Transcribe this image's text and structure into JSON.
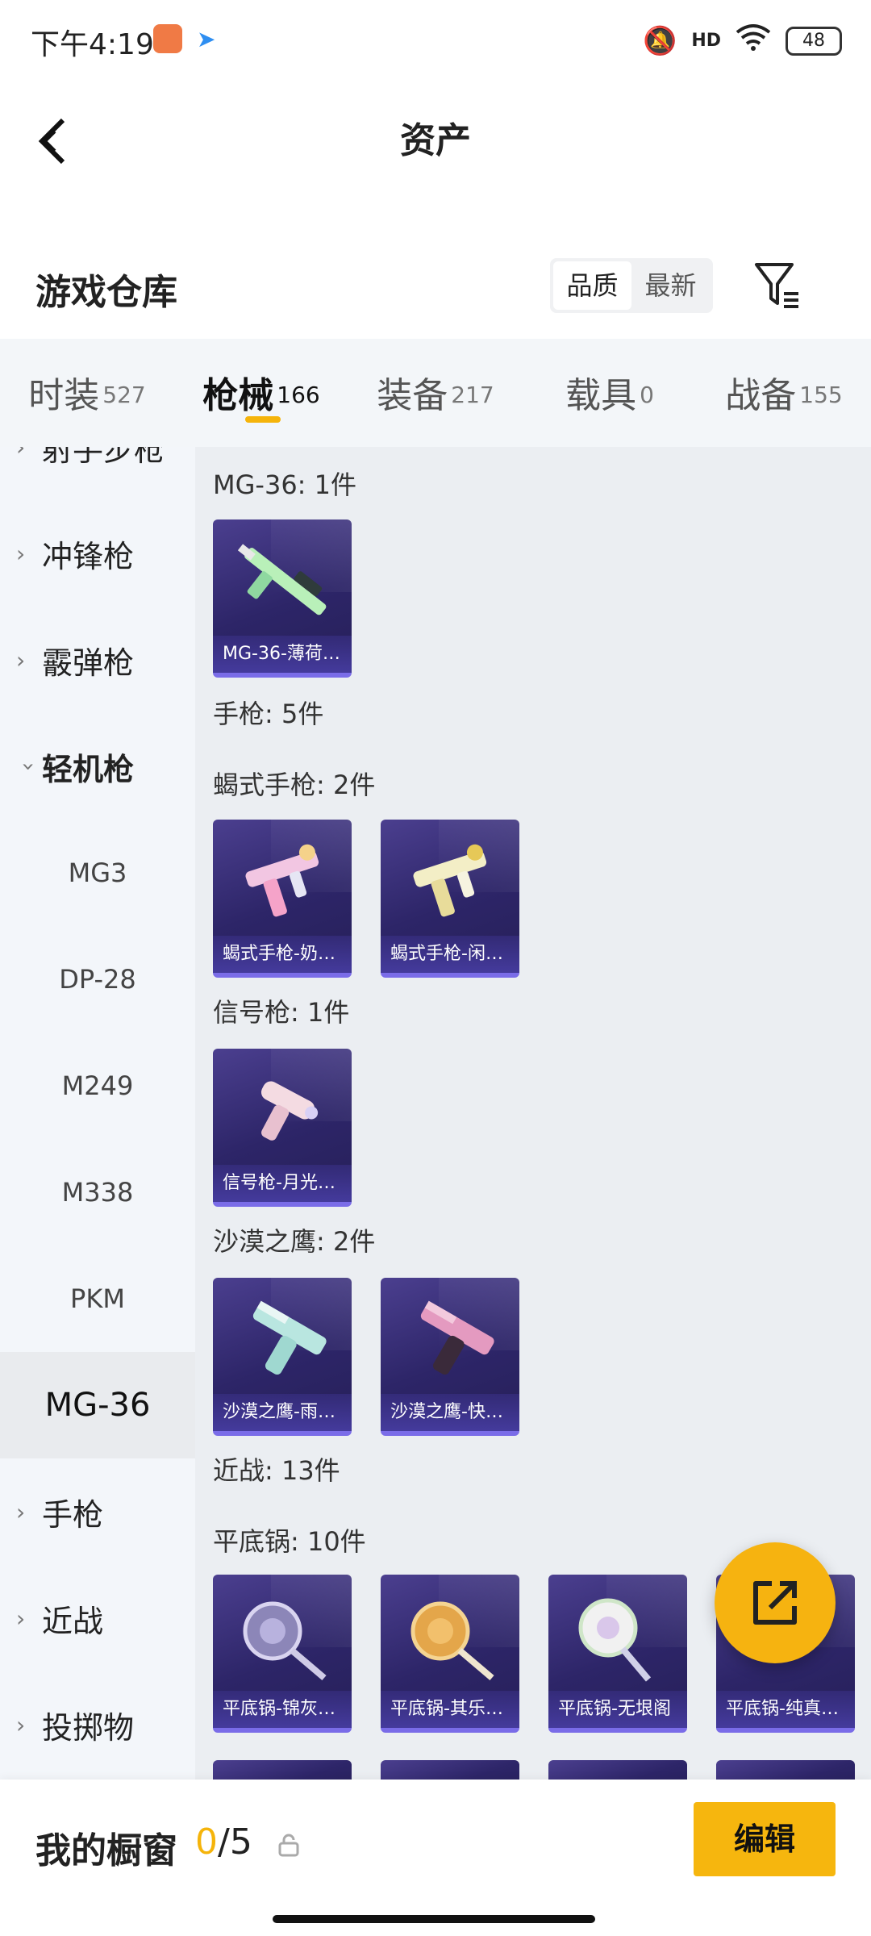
{
  "status_bar": {
    "time": "下午4:19",
    "battery": "48",
    "network": "HD"
  },
  "header": {
    "title": "资产"
  },
  "warehouse": {
    "title": "游戏仓库",
    "sort_options": [
      "品质",
      "最新"
    ],
    "active_sort": "品质"
  },
  "tabs": [
    {
      "label": "时装",
      "count": "527"
    },
    {
      "label": "枪械",
      "count": "166",
      "active": true
    },
    {
      "label": "装备",
      "count": "217"
    },
    {
      "label": "载具",
      "count": "0"
    },
    {
      "label": "战备",
      "count": "155"
    }
  ],
  "sidebar": {
    "categories": [
      "射手步枪",
      "冲锋枪",
      "霰弹枪",
      "轻机枪",
      "手枪",
      "近战",
      "投掷物"
    ],
    "expanded": "轻机枪",
    "subitems": [
      "MG3",
      "DP-28",
      "M249",
      "M338",
      "PKM",
      "MG-36"
    ],
    "active_subitem": "MG-36"
  },
  "content": {
    "sections": [
      "MG-36: 1件",
      "手枪: 5件",
      "蝎式手枪: 2件",
      "信号枪: 1件",
      "沙漠之鹰: 2件",
      "近战: 13件",
      "平底锅: 10件"
    ],
    "cards": [
      "MG-36-薄荷…",
      "蝎式手枪-奶…",
      "蝎式手枪-闲…",
      "信号枪-月光…",
      "沙漠之鹰-雨…",
      "沙漠之鹰-快…",
      "平底锅-锦灰…",
      "平底锅-其乐…",
      "平底锅-无垠阁",
      "平底锅-纯真…"
    ]
  },
  "bottom_bar": {
    "label": "我的橱窗",
    "current": "0",
    "total": "/5",
    "edit_label": "编辑"
  },
  "colors": {
    "accent": "#f5b40b",
    "card_bg": "#2d2568",
    "sidebar_bg": "#f3f6fa",
    "content_bg": "#ebeef2"
  },
  "icons": {
    "back": "chevron-left-icon",
    "filter": "filter-icon",
    "share": "share-external-icon",
    "lock": "lock-icon"
  }
}
